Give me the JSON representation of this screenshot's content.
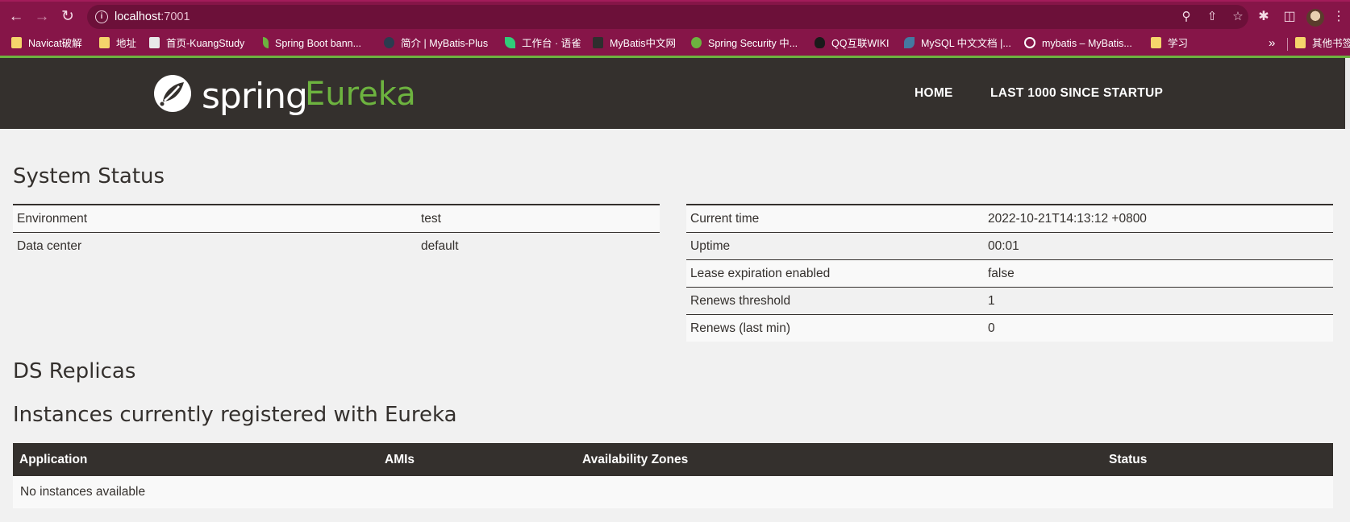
{
  "browser": {
    "url_host": "localhost",
    "url_port": ":7001",
    "bookmarks": [
      {
        "label": "Navicat破解",
        "icon": "folder-icon"
      },
      {
        "label": "地址",
        "icon": "folder-icon"
      },
      {
        "label": "首页-KuangStudy",
        "icon": "kuangstudy-icon"
      },
      {
        "label": "Spring Boot bann...",
        "icon": "spring-leaf-icon"
      },
      {
        "label": "简介 | MyBatis-Plus",
        "icon": "mybatis-plus-icon"
      },
      {
        "label": "工作台 · 语雀",
        "icon": "yuque-icon"
      },
      {
        "label": "MyBatis中文网",
        "icon": "mybatis-icon"
      },
      {
        "label": "Spring Security 中...",
        "icon": "spring-security-icon"
      },
      {
        "label": "QQ互联WIKI",
        "icon": "qq-icon"
      },
      {
        "label": "MySQL 中文文档 |...",
        "icon": "mysql-icon"
      },
      {
        "label": "mybatis – MyBatis...",
        "icon": "globe-icon"
      },
      {
        "label": "学习",
        "icon": "folder-icon"
      },
      {
        "label": "其他书签",
        "icon": "folder-icon"
      }
    ],
    "more_bookmarks": "»"
  },
  "navbar": {
    "logo_spring": "spring",
    "logo_eureka": "Eureka",
    "links": [
      "HOME",
      "LAST 1000 SINCE STARTUP"
    ]
  },
  "system_status": {
    "title": "System Status",
    "left": [
      {
        "key": "Environment",
        "value": "test"
      },
      {
        "key": "Data center",
        "value": "default"
      }
    ],
    "right": [
      {
        "key": "Current time",
        "value": "2022-10-21T14:13:12 +0800"
      },
      {
        "key": "Uptime",
        "value": "00:01"
      },
      {
        "key": "Lease expiration enabled",
        "value": "false"
      },
      {
        "key": "Renews threshold",
        "value": "1"
      },
      {
        "key": "Renews (last min)",
        "value": "0"
      }
    ]
  },
  "ds_replicas": {
    "title": "DS Replicas"
  },
  "instances": {
    "title": "Instances currently registered with Eureka",
    "columns": [
      "Application",
      "AMIs",
      "Availability Zones",
      "Status"
    ],
    "empty_message": "No instances available"
  },
  "colors": {
    "chrome": "#861548",
    "navbar": "#34302d",
    "spring_green": "#6db33f",
    "page_bg": "#f1f1f1"
  }
}
